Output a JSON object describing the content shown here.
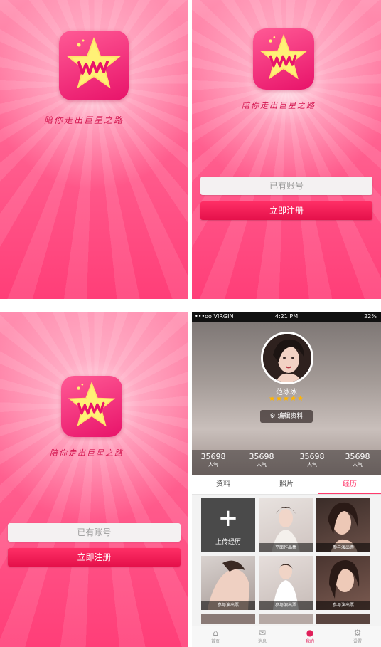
{
  "splash": {
    "tagline": "陪你走出巨星之路",
    "logo_text": "WM"
  },
  "auth": {
    "login_label": "已有账号",
    "register_label": "立即注册"
  },
  "status_bar": {
    "carrier": "•••oo VIRGIN",
    "time": "4:21 PM",
    "battery": "22%"
  },
  "profile": {
    "name": "范冰冰",
    "rating_stars": "★★★★★",
    "edit_label": "编辑资料",
    "stats": [
      {
        "value": "35698",
        "label": "人气"
      },
      {
        "value": "35698",
        "label": "人气"
      },
      {
        "value": "35698",
        "label": "人气"
      },
      {
        "value": "35698",
        "label": "人气"
      }
    ]
  },
  "tabs": [
    "资料",
    "照片",
    "经历"
  ],
  "active_tab": "经历",
  "experience": {
    "upload_label": "上传经历",
    "items": [
      "平面作品集",
      "参与演出票",
      "参与演出票",
      "参与演出票",
      "参与演出票"
    ]
  },
  "nav": [
    {
      "label": "首页",
      "icon": "home-icon"
    },
    {
      "label": "消息",
      "icon": "message-icon"
    },
    {
      "label": "我的",
      "icon": "user-icon"
    },
    {
      "label": "设置",
      "icon": "settings-icon"
    }
  ],
  "colors": {
    "brand_pink": "#ff3a6c",
    "register_red": "#e5104a"
  }
}
